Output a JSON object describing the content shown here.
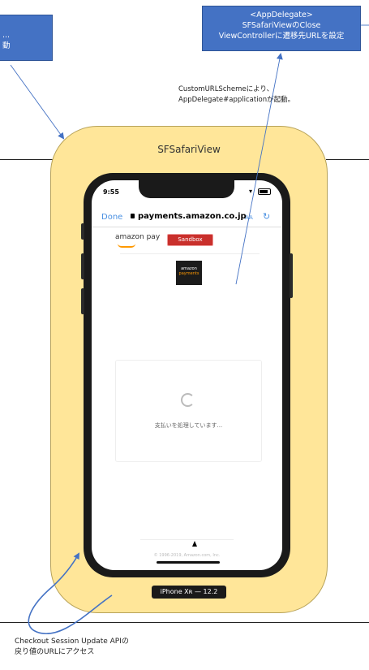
{
  "top_left_box": {
    "line1": "...",
    "line2": "動"
  },
  "top_right_box": {
    "line1": "<AppDelegate>",
    "line2": "SFSafariViewのClose",
    "line3": "ViewControllerに遷移先URLを設定"
  },
  "note_scheme": {
    "line1": "CustomURLSchemeにより、",
    "line2": "AppDelegate#applicationが起動。"
  },
  "frame_title": "SFSafariView",
  "phone": {
    "time": "9:55",
    "done_label": "Done",
    "url": "payments.amazon.co.jp",
    "aa_label": "AA",
    "reload_icon": "↻",
    "brand": "amazon pay",
    "sandbox_label": "Sandbox",
    "logo_line1": "amazon",
    "logo_line2": "payments",
    "processing_text": "支払いを処理しています...",
    "footer_text": "© 1996-2019, Amazon.com, Inc.",
    "device_label": "iPhone Xʀ — 12.2"
  },
  "bottom_note": {
    "line1": "Checkout Session Update APIの",
    "line2": "戻り値のURLにアクセス"
  },
  "colors": {
    "box_fill": "#4472c4",
    "frame_fill": "#ffe699",
    "arrow": "#4472c4"
  }
}
